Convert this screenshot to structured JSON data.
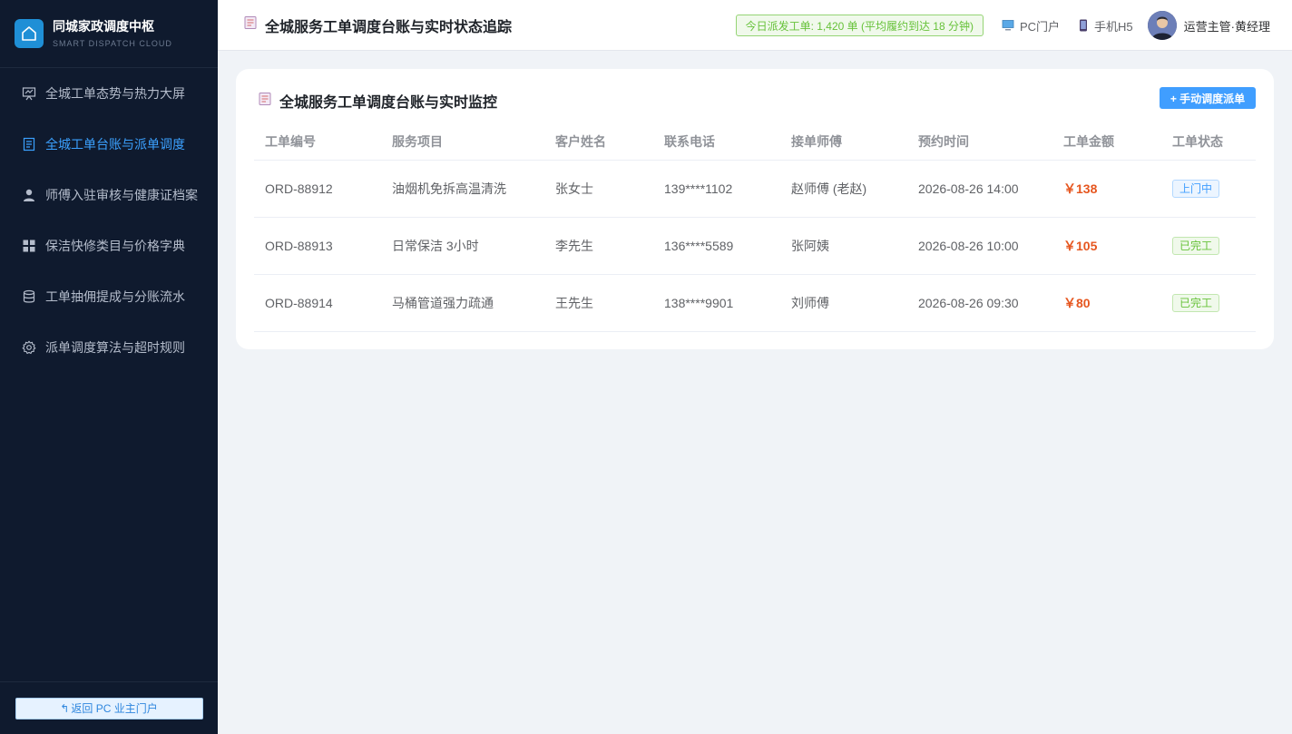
{
  "brand": {
    "title": "同城家政调度中枢",
    "subtitle": "SMART DISPATCH CLOUD",
    "logo_icon": "home-icon"
  },
  "sidebar": {
    "items": [
      {
        "label": "全城工单态势与热力大屏",
        "icon": "presentation-icon",
        "active": false
      },
      {
        "label": "全城工单台账与派单调度",
        "icon": "document-icon",
        "active": true
      },
      {
        "label": "师傅入驻审核与健康证档案",
        "icon": "user-icon",
        "active": false
      },
      {
        "label": "保洁快修类目与价格字典",
        "icon": "grid-icon",
        "active": false
      },
      {
        "label": "工单抽佣提成与分账流水",
        "icon": "database-icon",
        "active": false
      },
      {
        "label": "派单调度算法与超时规则",
        "icon": "gear-icon",
        "active": false
      }
    ],
    "back_label": "返回 PC 业主门户"
  },
  "header": {
    "title": "全城服务工单调度台账与实时状态追踪",
    "stat": "今日派发工单: 1,420 单 (平均履约到达 18 分钟)",
    "pc_link": "PC门户",
    "mobile_link": "手机H5",
    "user_name": "运营主管·黄经理"
  },
  "card": {
    "title": "全城服务工单调度台账与实时监控",
    "button_label": "+ 手动调度派单"
  },
  "table": {
    "columns": [
      "工单编号",
      "服务项目",
      "客户姓名",
      "联系电话",
      "接单师傅",
      "预约时间",
      "工单金额",
      "工单状态"
    ],
    "rows": [
      {
        "id": "ORD-88912",
        "service": "油烟机免拆高温清洗",
        "customer": "张女士",
        "phone": "139****1102",
        "worker": "赵师傅 (老赵)",
        "time": "2026-08-26 14:00",
        "amount": "￥138",
        "status": "上门中",
        "status_type": "progress"
      },
      {
        "id": "ORD-88913",
        "service": "日常保洁 3小时",
        "customer": "李先生",
        "phone": "136****5589",
        "worker": "张阿姨",
        "time": "2026-08-26 10:00",
        "amount": "￥105",
        "status": "已完工",
        "status_type": "done"
      },
      {
        "id": "ORD-88914",
        "service": "马桶管道强力疏通",
        "customer": "王先生",
        "phone": "138****9901",
        "worker": "刘师傅",
        "time": "2026-08-26 09:30",
        "amount": "￥80",
        "status": "已完工",
        "status_type": "done"
      }
    ]
  },
  "colors": {
    "sidebar_bg": "#0f1a2e",
    "accent": "#409eff",
    "active_nav": "#3ba1ff",
    "amount": "#e6561f",
    "success": "#67c23a"
  }
}
